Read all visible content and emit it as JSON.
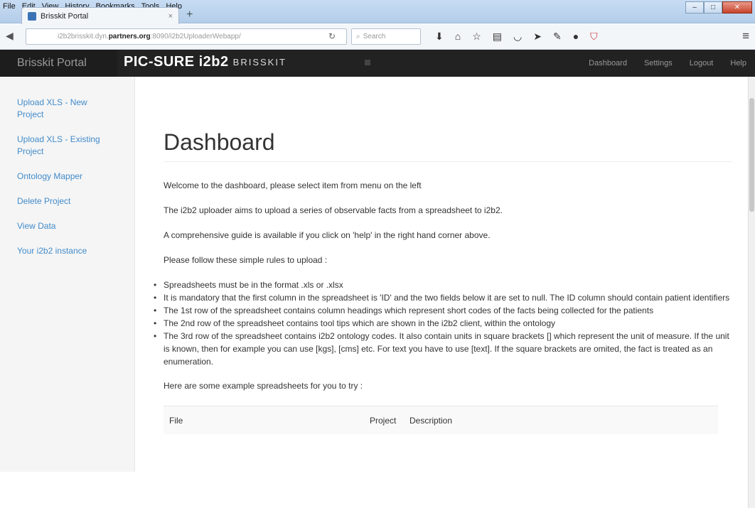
{
  "browser": {
    "menu": [
      "File",
      "Edit",
      "View",
      "History",
      "Bookmarks",
      "Tools",
      "Help"
    ],
    "tab_title": "Brisskit Portal",
    "tab_close": "×",
    "new_tab": "+",
    "url_prefix": "i2b2brisskit.dyn.",
    "url_domain": "partners.org",
    "url_suffix": ":8090/i2b2UploaderWebapp/",
    "search_placeholder": "Search"
  },
  "app": {
    "brand": "Brisskit Portal",
    "logo_text": "PIC-SURE i2b2",
    "logo_sub": "BRISSKIT",
    "nav": [
      "Dashboard",
      "Settings",
      "Logout",
      "Help"
    ]
  },
  "sidebar": {
    "items": [
      {
        "label": "Upload XLS - New Project"
      },
      {
        "label": "Upload XLS - Existing Project"
      },
      {
        "label": "Ontology Mapper"
      },
      {
        "label": "Delete Project"
      },
      {
        "label": "View Data"
      },
      {
        "label": "Your i2b2 instance"
      }
    ]
  },
  "main": {
    "title": "Dashboard",
    "paragraphs": [
      "Welcome to the dashboard, please select item from menu on the left",
      "The i2b2 uploader aims to upload a series of observable facts from a spreadsheet to i2b2.",
      "A comprehensive guide is available if you click on 'help' in the right hand corner above.",
      "Please follow these simple rules to upload :"
    ],
    "rules": [
      "Spreadsheets must be in the format .xls or .xlsx",
      "It is mandatory that the first column in the spreadsheet is 'ID' and the two fields below it are set to null. The ID column should contain patient identifiers",
      "The 1st row of the spreadsheet contains column headings which represent short codes of the facts being collected for the patients",
      "The 2nd row of the spreadsheet contains tool tips which are shown in the i2b2 client, within the ontology",
      "The 3rd row of the spreadsheet contains i2b2 ontology codes. It also contain units in square brackets [] which represent the unit of measure. If the unit is known, then for example you can use [kgs], [cms] etc. For text you have to use [text]. If the square brackets are omited, the fact is treated as an enumeration."
    ],
    "examples_intro": "Here are some example spreadsheets for you to try :",
    "table_headers": {
      "file": "File",
      "project": "Project",
      "description": "Description"
    }
  }
}
